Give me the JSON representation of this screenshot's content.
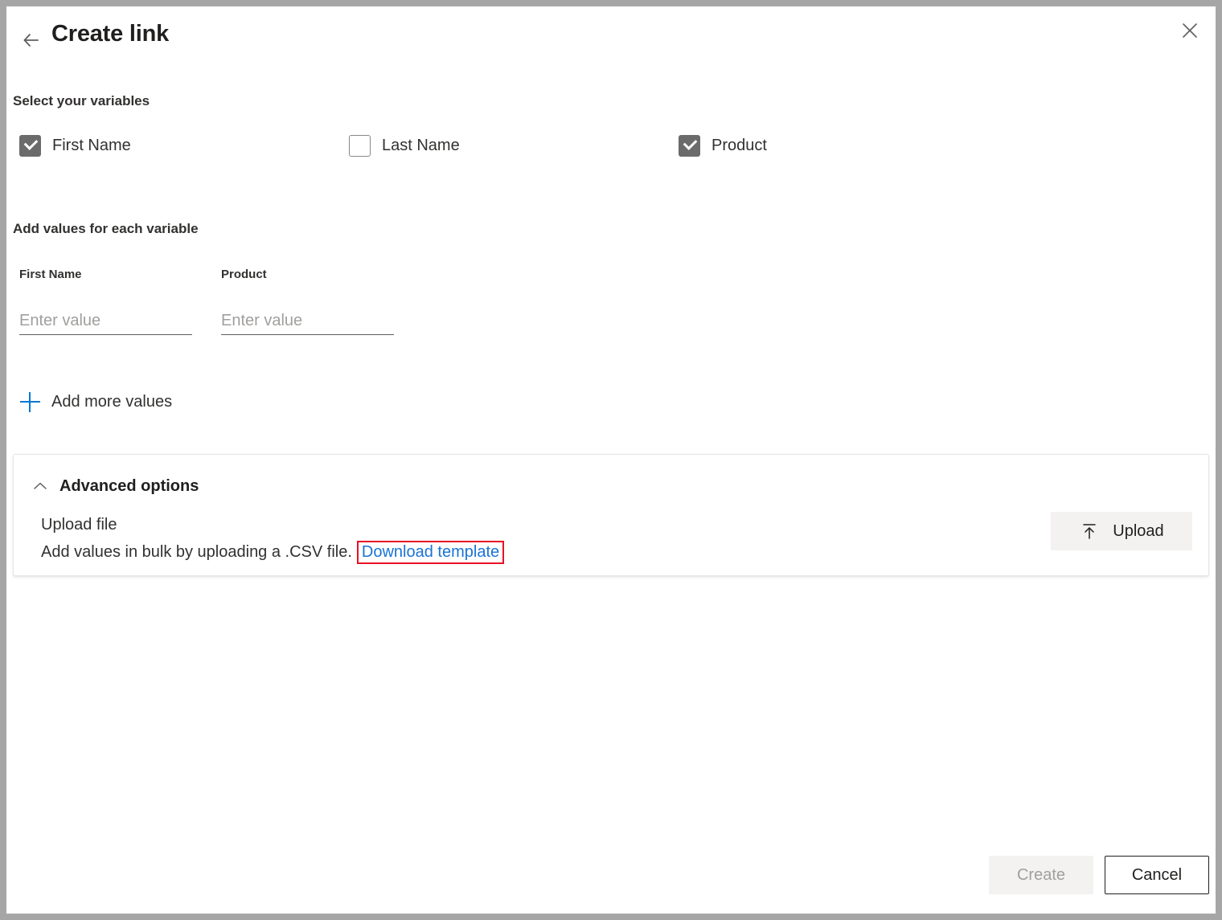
{
  "header": {
    "title": "Create link",
    "back_icon": "arrow-left-icon",
    "close_icon": "close-icon"
  },
  "sections": {
    "select_variables_heading": "Select your variables",
    "add_values_heading": "Add values for each variable"
  },
  "variables": [
    {
      "label": "First Name",
      "checked": true
    },
    {
      "label": "Last Name",
      "checked": false
    },
    {
      "label": "Product",
      "checked": true
    }
  ],
  "value_fields": [
    {
      "label": "First Name",
      "value": "",
      "placeholder": "Enter value"
    },
    {
      "label": "Product",
      "value": "",
      "placeholder": "Enter value"
    }
  ],
  "add_more_values": {
    "label": "Add more values",
    "icon": "plus-icon",
    "icon_color": "#0078d4"
  },
  "advanced_options": {
    "label": "Advanced options",
    "toggle_icon": "chevron-up-icon",
    "expanded": true,
    "upload_file_title": "Upload file",
    "upload_description": "Add values in bulk by uploading a .CSV file.",
    "download_template_link": "Download template",
    "download_template_link_color": "#1a73d4",
    "highlight_color": "#e81123",
    "upload_button": {
      "label": "Upload",
      "icon": "upload-icon"
    }
  },
  "footer": {
    "create_label": "Create",
    "create_disabled": true,
    "cancel_label": "Cancel"
  }
}
